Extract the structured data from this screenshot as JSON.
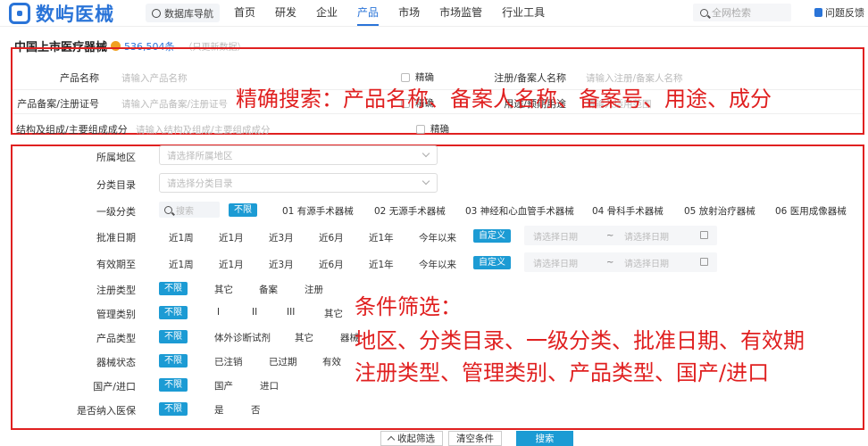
{
  "header": {
    "logo_text": "数屿医械",
    "db_nav": "数据库导航",
    "nav": [
      "首页",
      "研发",
      "企业",
      "产品",
      "市场",
      "市场监管",
      "行业工具"
    ],
    "active_nav": "产品",
    "search_placeholder": "全网检索",
    "feedback": "问题反馈"
  },
  "title": {
    "text": "中国上市医疗器械",
    "count": "536,504条",
    "note": "（只更新数据）"
  },
  "precise": {
    "product_name_label": "产品名称",
    "product_name_ph": "请输入产品名称",
    "exact1": "精确",
    "registrant_label": "注册/备案人名称",
    "registrant_ph": "请输入注册/备案人名称",
    "record_no_label": "产品备案/注册证号",
    "record_no_ph": "请输入产品备案/注册证号",
    "exact2": "精确",
    "usage_label": "用途/预期用途",
    "usage_ph": "请输入适用范围",
    "composition_label": "结构及组成/主要组成成分",
    "composition_ph": "请输入结构及组成/主要组成成分",
    "exact3": "精确"
  },
  "filters": {
    "region_label": "所属地区",
    "region_ph": "请选择所属地区",
    "catalog_label": "分类目录",
    "catalog_ph": "请选择分类目录",
    "level1_label": "一级分类",
    "level1_search": "搜索",
    "level1_options": [
      "不限",
      "01 有源手术器械",
      "02 无源手术器械",
      "03 神经和心血管手术器械",
      "04 骨科手术器械",
      "05 放射治疗器械",
      "06 医用成像器械"
    ],
    "approve_label": "批准日期",
    "date_options": [
      "近1周",
      "近1月",
      "近3月",
      "近6月",
      "近1年",
      "今年以来"
    ],
    "custom": "自定义",
    "date_start_ph": "请选择日期",
    "date_tilde": "~",
    "date_end_ph": "请选择日期",
    "valid_label": "有效期至",
    "reg_type_label": "注册类型",
    "reg_type_options": [
      "不限",
      "其它",
      "备案",
      "注册"
    ],
    "mgmt_label": "管理类别",
    "mgmt_options": [
      "不限",
      "I",
      "II",
      "III",
      "其它"
    ],
    "product_type_label": "产品类型",
    "product_type_options": [
      "不限",
      "体外诊断试剂",
      "其它",
      "器械"
    ],
    "status_label": "器械状态",
    "status_options": [
      "不限",
      "已注销",
      "已过期",
      "有效"
    ],
    "origin_label": "国产/进口",
    "origin_options": [
      "不限",
      "国产",
      "进口"
    ],
    "insurance_label": "是否纳入医保",
    "insurance_options": [
      "不限",
      "是",
      "否"
    ]
  },
  "annotations": {
    "precise_note": "精确搜索：产品名称、备案人名称、备案号、用途、成分",
    "filter_note_1": "条件筛选：",
    "filter_note_2": "地区、分类目录、一级分类、批准日期、有效期",
    "filter_note_3": "注册类型、管理类别、产品类型、国产/进口"
  },
  "bottom": {
    "collapse": "收起筛选",
    "clear": "清空条件",
    "search": "搜索"
  },
  "colors": {
    "brand": "#2a74d8",
    "accent": "#1c9bd4",
    "annotation": "#e02020"
  }
}
